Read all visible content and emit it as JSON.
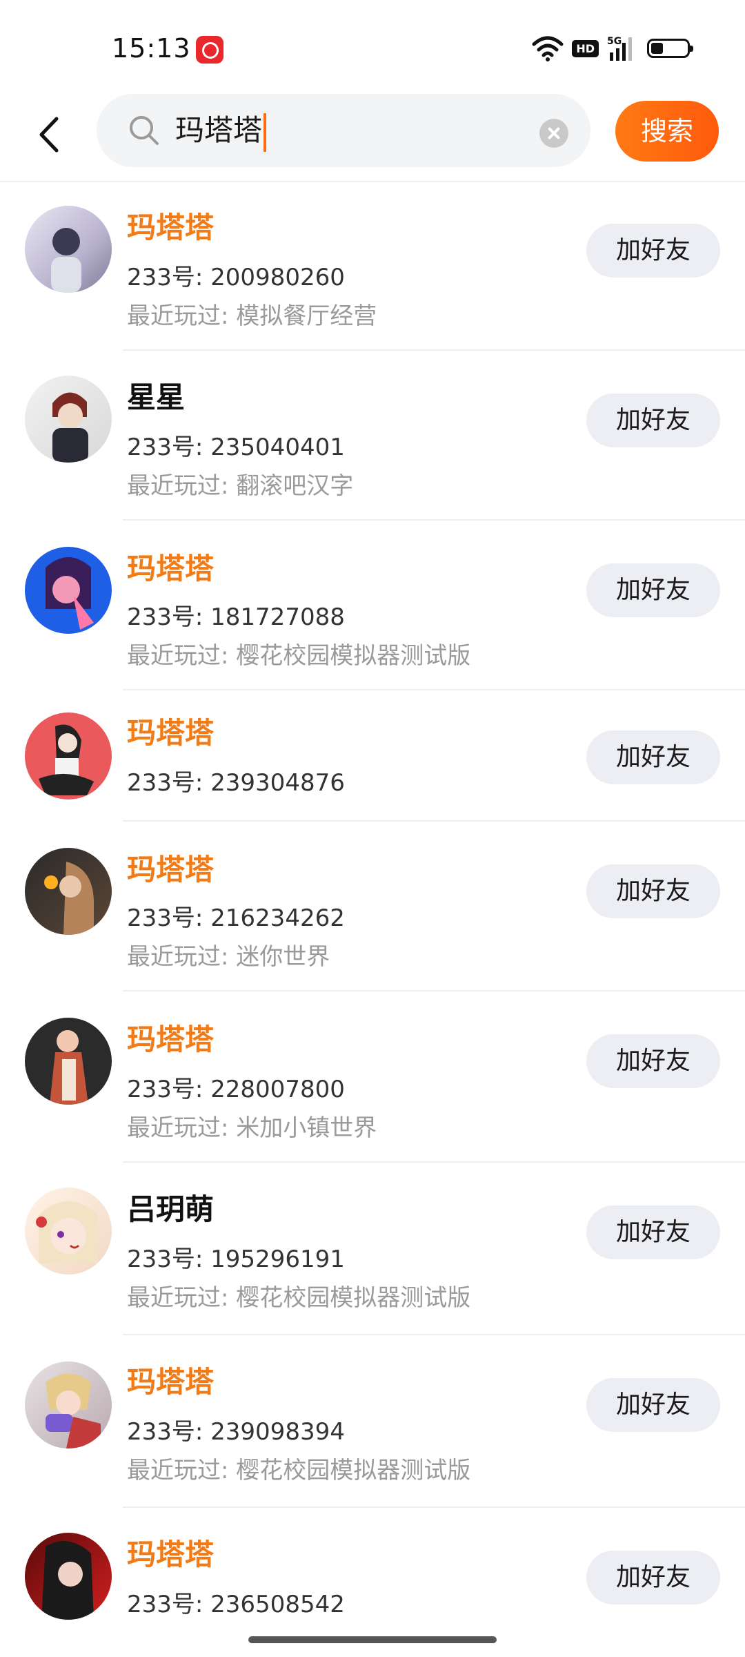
{
  "status_bar": {
    "time": "15:13",
    "hd_label": "HD",
    "network_label": "5G",
    "icons": [
      "app-notification-icon",
      "wifi-icon",
      "hd-icon",
      "signal-5g-icon",
      "battery-icon"
    ]
  },
  "search": {
    "query": "玛塔塔",
    "button_label": "搜索",
    "icons": [
      "back-icon",
      "search-icon",
      "clear-icon"
    ],
    "accent_color": "#ff6a14"
  },
  "results": [
    {
      "name": "玛塔塔",
      "name_highlight": true,
      "id_text": "233号: 200980260",
      "played": "最近玩过: 模拟餐厅经营",
      "button": "加好友"
    },
    {
      "name": "星星",
      "name_highlight": false,
      "id_text": "233号: 235040401",
      "played": "最近玩过: 翻滚吧汉字",
      "button": "加好友"
    },
    {
      "name": "玛塔塔",
      "name_highlight": true,
      "id_text": "233号: 181727088",
      "played": "最近玩过: 樱花校园模拟器测试版",
      "button": "加好友"
    },
    {
      "name": "玛塔塔",
      "name_highlight": true,
      "id_text": "233号: 239304876",
      "played": "",
      "button": "加好友"
    },
    {
      "name": "玛塔塔",
      "name_highlight": true,
      "id_text": "233号: 216234262",
      "played": "最近玩过: 迷你世界",
      "button": "加好友"
    },
    {
      "name": "玛塔塔",
      "name_highlight": true,
      "id_text": "233号: 228007800",
      "played": "最近玩过: 米加小镇世界",
      "button": "加好友"
    },
    {
      "name": "吕玥萌",
      "name_highlight": false,
      "id_text": "233号: 195296191",
      "played": "最近玩过: 樱花校园模拟器测试版",
      "button": "加好友"
    },
    {
      "name": "玛塔塔",
      "name_highlight": true,
      "id_text": "233号: 239098394",
      "played": "最近玩过: 樱花校园模拟器测试版",
      "button": "加好友"
    },
    {
      "name": "玛塔塔",
      "name_highlight": true,
      "id_text": "233号: 236508542",
      "played": "",
      "button": "加好友"
    }
  ],
  "colors": {
    "highlight_name": "#f37b16",
    "search_button": "#ff6a14",
    "add_button_bg": "#eceef3"
  }
}
